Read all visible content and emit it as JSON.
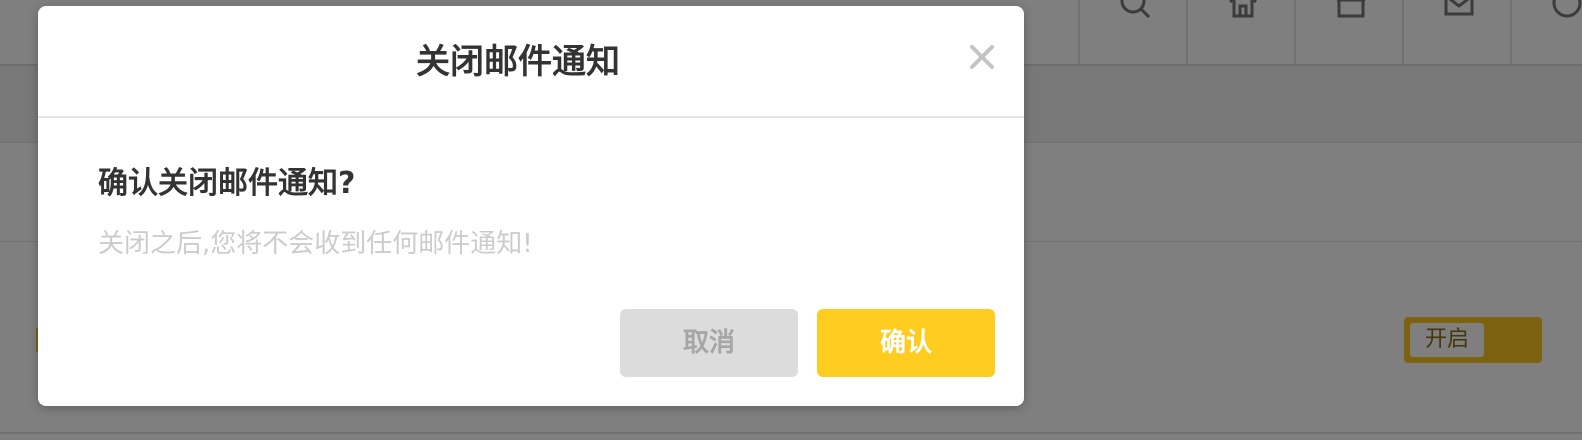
{
  "dialog": {
    "title": "关闭邮件通知",
    "close_icon": "close-icon",
    "heading": "确认关闭邮件通知?",
    "description": "关闭之后,您将不会收到任何邮件通知!",
    "cancel_label": "取消",
    "confirm_label": "确认"
  },
  "background": {
    "toggle_label": "开启",
    "header_icons": [
      "search-icon",
      "home-icon",
      "store-icon",
      "mail-icon",
      "more-icon"
    ]
  },
  "colors": {
    "accent": "#fecd1f",
    "overlay": "rgba(0,0,0,0.5)",
    "cancel_bg": "#dcdcdc",
    "title_text": "#333333",
    "description_text": "#cccccc"
  }
}
